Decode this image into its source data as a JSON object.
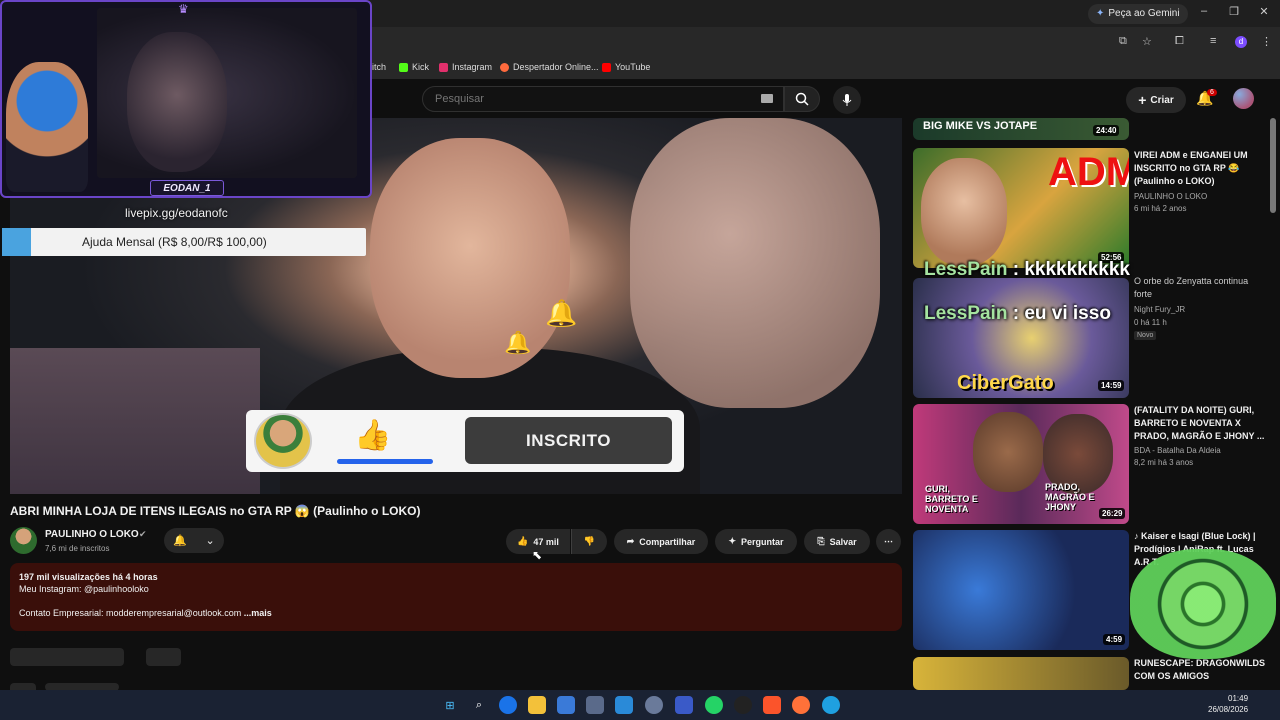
{
  "browser": {
    "gemini_label": "Peça ao Gemini",
    "profile_letter": "d",
    "bookmarks": [
      {
        "label": "itch",
        "color": "#9146ff"
      },
      {
        "label": "Kick",
        "color": "#53fc18"
      },
      {
        "label": "Instagram",
        "color": "#e1306c"
      },
      {
        "label": "Despertador Online...",
        "color": "#ff6a3d"
      },
      {
        "label": "YouTube",
        "color": "#ff0000"
      }
    ]
  },
  "masthead": {
    "search_placeholder": "Pesquisar",
    "create_label": "Criar",
    "notification_count": "6"
  },
  "stream_overlay": {
    "streamer_name": "EODAN_1",
    "livepix": "livepix.gg/eodanofc",
    "goal_text": "Ajuda Mensal (R$ 8,00/R$ 100,00)",
    "goal_progress": 0.08
  },
  "player": {
    "subscribe_label": "INSCRITO"
  },
  "video": {
    "title": "ABRI MINHA LOJA DE ITENS ILEGAIS no GTA RP 😱 (Paulinho o LOKO)",
    "channel": "PAULINHO O LOKO",
    "subscribers": "7,6 mi de inscritos",
    "likes": "47 mil",
    "share": "Compartilhar",
    "ask": "Perguntar",
    "save": "Salvar",
    "description": {
      "stats": "197 mil visualizações  há 4 horas",
      "line1": "Meu Instagram: @paulinhooloko",
      "line2": "Contato Empresarial: modderempresarial@outlook.com",
      "more": "...mais"
    }
  },
  "sidebar": {
    "items": [
      {
        "duration": "24:40",
        "thumb_text": "BIG MIKE VS JOTAPE"
      },
      {
        "title": "VIREI ADM e ENGANEI UM INSCRITO no GTA RP 😂 (Paulinho o LOKO)",
        "channel": "PAULINHO O LOKO",
        "meta": "6 mi  há 2 anos",
        "duration": "52:56",
        "thumb_text": "ADM"
      },
      {
        "title": "O orbe do Zenyatta continua forte",
        "channel": "Night Fury_JR",
        "meta": "0  há 11 h",
        "badge": "Novo",
        "duration": "14:59",
        "thumb_text": "CiberGato"
      },
      {
        "title": "(FATALITY DA NOITE) GURI, BARRETO E NOVENTA X PRADO, MAGRÃO E JHONY ...",
        "channel": "BDA - Batalha Da Aldeia",
        "meta": "8,2 mi  há 3 anos",
        "duration": "26:29",
        "thumb_left": "GURI, BARRETO E NOVENTA",
        "thumb_right": "PRADO, MAGRÃO E JHONY"
      },
      {
        "title": "♪ Kaiser e Isagi (Blue Lock) | Prodígios | AniRap ft. Lucas A.R.T.",
        "duration": "4:59"
      },
      {
        "title": "RUNESCAPE: DRAGONWILDS COM OS AMIGOS"
      }
    ]
  },
  "chat": [
    {
      "name": "LessPain",
      "message": "kkkkkkkkkk"
    },
    {
      "name": "LessPain",
      "message": "eu vi isso"
    }
  ],
  "taskbar": {
    "time": "01:49",
    "date": "26/08/2026"
  }
}
